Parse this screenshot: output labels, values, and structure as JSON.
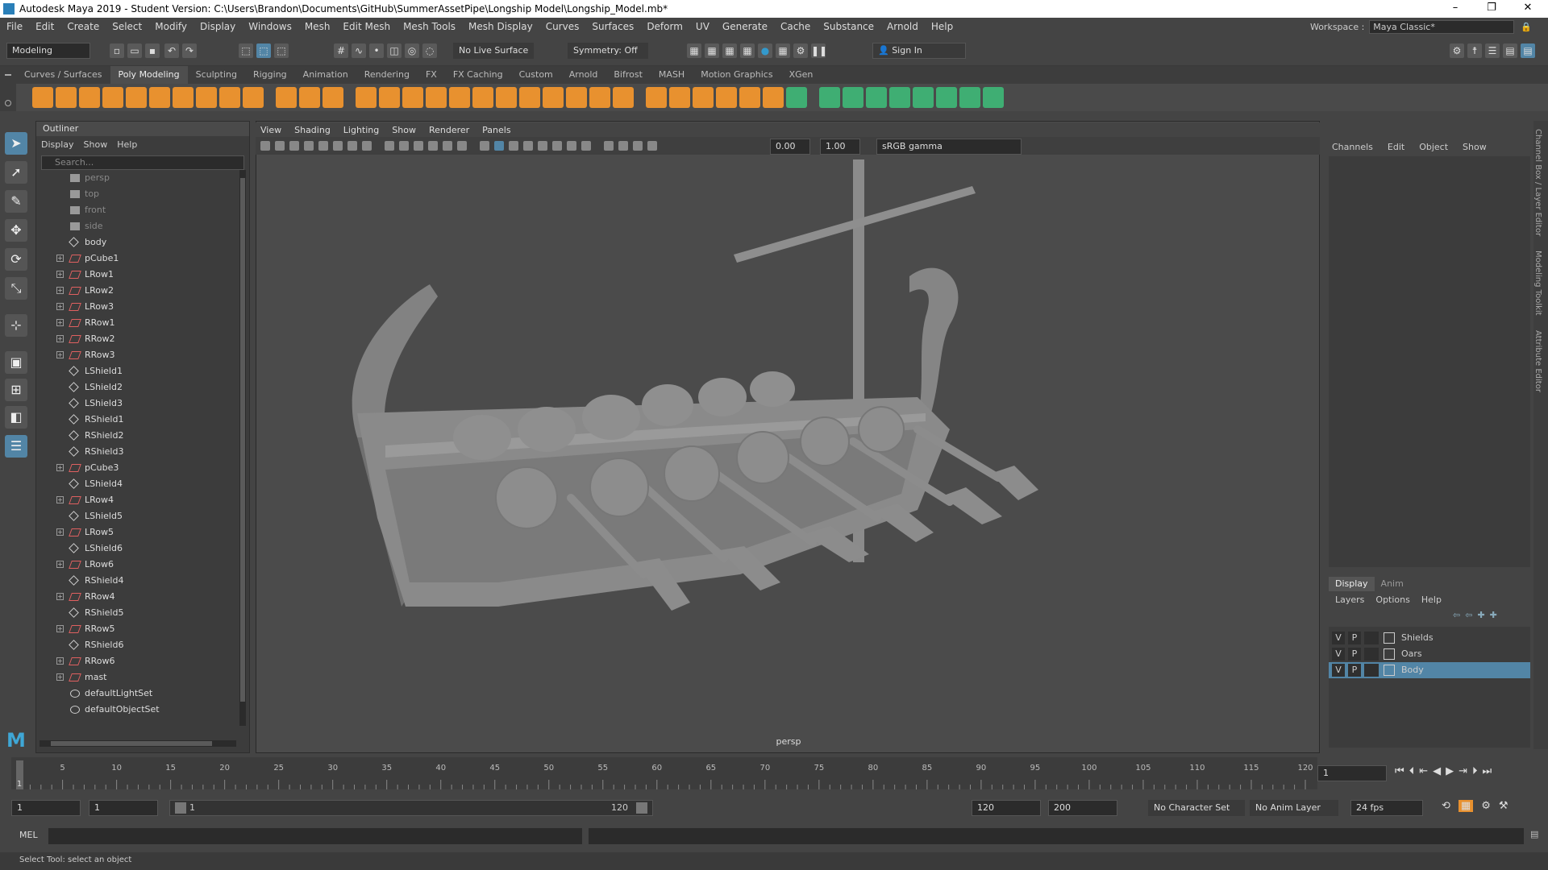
{
  "titlebar": {
    "title": "Autodesk Maya 2019 - Student Version: C:\\Users\\Brandon\\Documents\\GitHub\\SummerAssetPipe\\Longship Model\\Longship_Model.mb*"
  },
  "menubar": {
    "items": [
      "File",
      "Edit",
      "Create",
      "Select",
      "Modify",
      "Display",
      "Windows",
      "Mesh",
      "Edit Mesh",
      "Mesh Tools",
      "Mesh Display",
      "Curves",
      "Surfaces",
      "Deform",
      "UV",
      "Generate",
      "Cache",
      "Substance",
      "Arnold",
      "Help"
    ]
  },
  "workspace": {
    "label": "Workspace :",
    "value": "Maya Classic*"
  },
  "status": {
    "mode": "Modeling",
    "live_surface": "No Live Surface",
    "symmetry": "Symmetry: Off",
    "sign_in": "Sign In"
  },
  "shelf": {
    "tabs": [
      "Curves / Surfaces",
      "Poly Modeling",
      "Sculpting",
      "Rigging",
      "Animation",
      "Rendering",
      "FX",
      "FX Caching",
      "Custom",
      "Arnold",
      "Bifrost",
      "MASH",
      "Motion Graphics",
      "XGen"
    ],
    "active": "Poly Modeling"
  },
  "outliner": {
    "title": "Outliner",
    "menu": [
      "Display",
      "Show",
      "Help"
    ],
    "search_placeholder": "Search...",
    "items": [
      {
        "label": "persp",
        "type": "camera"
      },
      {
        "label": "top",
        "type": "camera"
      },
      {
        "label": "front",
        "type": "camera"
      },
      {
        "label": "side",
        "type": "camera"
      },
      {
        "label": "body",
        "type": "group"
      },
      {
        "label": "pCube1",
        "type": "mesh"
      },
      {
        "label": "LRow1",
        "type": "mesh"
      },
      {
        "label": "LRow2",
        "type": "mesh"
      },
      {
        "label": "LRow3",
        "type": "mesh"
      },
      {
        "label": "RRow1",
        "type": "mesh"
      },
      {
        "label": "RRow2",
        "type": "mesh"
      },
      {
        "label": "RRow3",
        "type": "mesh"
      },
      {
        "label": "LShield1",
        "type": "group"
      },
      {
        "label": "LShield2",
        "type": "group"
      },
      {
        "label": "LShield3",
        "type": "group"
      },
      {
        "label": "RShield1",
        "type": "group"
      },
      {
        "label": "RShield2",
        "type": "group"
      },
      {
        "label": "RShield3",
        "type": "group"
      },
      {
        "label": "pCube3",
        "type": "mesh"
      },
      {
        "label": "LShield4",
        "type": "group"
      },
      {
        "label": "LRow4",
        "type": "mesh"
      },
      {
        "label": "LShield5",
        "type": "group"
      },
      {
        "label": "LRow5",
        "type": "mesh"
      },
      {
        "label": "LShield6",
        "type": "group"
      },
      {
        "label": "LRow6",
        "type": "mesh"
      },
      {
        "label": "RShield4",
        "type": "group"
      },
      {
        "label": "RRow4",
        "type": "mesh"
      },
      {
        "label": "RShield5",
        "type": "group"
      },
      {
        "label": "RRow5",
        "type": "mesh"
      },
      {
        "label": "RShield6",
        "type": "group"
      },
      {
        "label": "RRow6",
        "type": "mesh"
      },
      {
        "label": "mast",
        "type": "mesh"
      },
      {
        "label": "defaultLightSet",
        "type": "set"
      },
      {
        "label": "defaultObjectSet",
        "type": "set"
      }
    ]
  },
  "viewport": {
    "menu": [
      "View",
      "Shading",
      "Lighting",
      "Show",
      "Renderer",
      "Panels"
    ],
    "exposure": "0.00",
    "gamma": "1.00",
    "color_space": "sRGB gamma",
    "camera_label": "persp"
  },
  "channel_box": {
    "menu": [
      "Channels",
      "Edit",
      "Object",
      "Show"
    ],
    "side_tabs": [
      "Channel Box / Layer Editor",
      "Modeling Toolkit",
      "Attribute Editor"
    ]
  },
  "layer_editor": {
    "tabs": [
      "Display",
      "Anim"
    ],
    "menu": [
      "Layers",
      "Options",
      "Help"
    ],
    "layers": [
      {
        "name": "Shields",
        "v": "V",
        "p": "P"
      },
      {
        "name": "Oars",
        "v": "V",
        "p": "P"
      },
      {
        "name": "Body",
        "v": "V",
        "p": "P",
        "selected": true
      }
    ]
  },
  "timeline": {
    "ticks": [
      "5",
      "10",
      "15",
      "20",
      "25",
      "30",
      "35",
      "40",
      "45",
      "50",
      "55",
      "60",
      "65",
      "70",
      "75",
      "80",
      "85",
      "90",
      "95",
      "100",
      "105",
      "110",
      "115",
      "120"
    ],
    "current_frame": "1",
    "start_marker": "1"
  },
  "range": {
    "start": "1",
    "anim_start": "1",
    "slider_start": "1",
    "slider_end": "120",
    "end": "120",
    "anim_end": "200",
    "character_set": "No Character Set",
    "anim_layer": "No Anim Layer",
    "fps": "24 fps"
  },
  "mel": {
    "label": "MEL"
  },
  "helpline": {
    "text": "Select Tool: select an object"
  },
  "colors": {
    "accent": "#5285a6",
    "shelf_orange": "#e8912f",
    "shelf_green": "#3fae73"
  }
}
